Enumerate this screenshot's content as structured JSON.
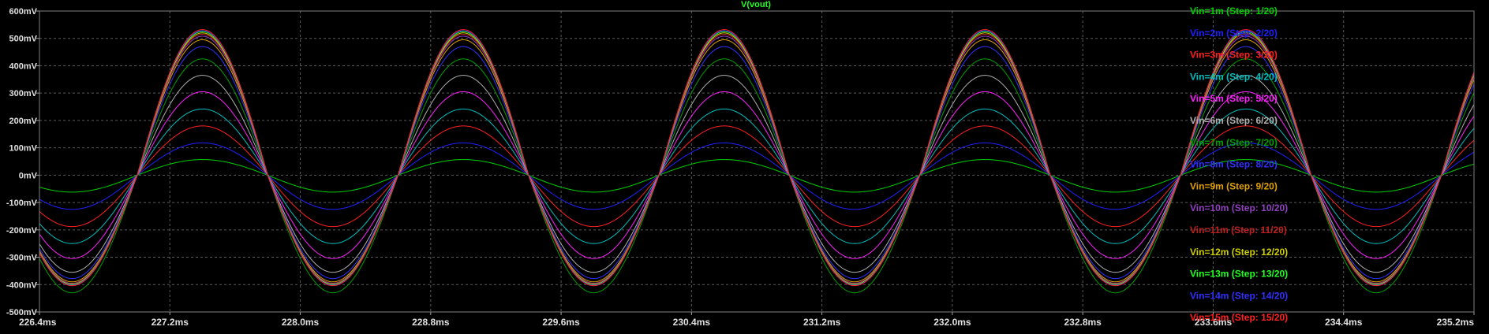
{
  "chart_data": {
    "type": "line",
    "title": "V(vout)",
    "xlabel": "",
    "ylabel": "",
    "xlim": [
      226.4,
      235.2
    ],
    "ylim": [
      -500,
      600
    ],
    "x_unit": "ms",
    "y_unit": "mV",
    "x_ticks": [
      "226.4ms",
      "227.2ms",
      "228.0ms",
      "228.8ms",
      "229.6ms",
      "230.4ms",
      "231.2ms",
      "232.0ms",
      "232.8ms",
      "233.6ms",
      "234.4ms",
      "235.2ms"
    ],
    "x_tick_values": [
      226.4,
      227.2,
      228.0,
      228.8,
      229.6,
      230.4,
      231.2,
      232.0,
      232.8,
      233.6,
      234.4,
      235.2
    ],
    "y_ticks": [
      "600mV",
      "500mV",
      "400mV",
      "300mV",
      "200mV",
      "100mV",
      "0mV",
      "-100mV",
      "-200mV",
      "-300mV",
      "-400mV",
      "-500mV"
    ],
    "y_tick_values": [
      600,
      500,
      400,
      300,
      200,
      100,
      0,
      -100,
      -200,
      -300,
      -400,
      -500
    ],
    "grid": true,
    "grid_style": "dashed",
    "legend_position": "right",
    "signal_period_ms": 1.6,
    "first_rising_zero_ms": 227.0,
    "series": [
      {
        "name": "Vin=1m  (Step: 1/20)",
        "color": "#00d000",
        "peak": 57,
        "trough": -62
      },
      {
        "name": "Vin=2m  (Step: 2/20)",
        "color": "#2020ff",
        "peak": 118,
        "trough": -125
      },
      {
        "name": "Vin=3m  (Step: 3/20)",
        "color": "#ff2020",
        "peak": 180,
        "trough": -188
      },
      {
        "name": "Vin=4m  (Step: 4/20)",
        "color": "#00c0c0",
        "peak": 242,
        "trough": -250
      },
      {
        "name": "Vin=5m  (Step: 5/20)",
        "color": "#ff20ff",
        "peak": 305,
        "trough": -305
      },
      {
        "name": "Vin=6m  (Step: 6/20)",
        "color": "#b0b0b0",
        "peak": 365,
        "trough": -355
      },
      {
        "name": "Vin=7m  (Step: 7/20)",
        "color": "#00a000",
        "peak": 425,
        "trough": -430
      },
      {
        "name": "Vin=8m  (Step: 8/20)",
        "color": "#3030ff",
        "peak": 470,
        "trough": -378
      },
      {
        "name": "Vin=9m  (Step: 9/20)",
        "color": "#e0a000",
        "peak": 495,
        "trough": -390
      },
      {
        "name": "Vin=10m  (Step: 10/20)",
        "color": "#9040c0",
        "peak": 508,
        "trough": -395
      },
      {
        "name": "Vin=11m  (Step: 11/20)",
        "color": "#c02020",
        "peak": 515,
        "trough": -397
      },
      {
        "name": "Vin=12m  (Step: 12/20)",
        "color": "#d0d000",
        "peak": 520,
        "trough": -399
      },
      {
        "name": "Vin=13m  (Step: 13/20)",
        "color": "#20ff20",
        "peak": 525,
        "trough": -400
      },
      {
        "name": "Vin=14m  (Step: 14/20)",
        "color": "#3030ff",
        "peak": 528,
        "trough": -402
      },
      {
        "name": "Vin=15m  (Step: 15/20)",
        "color": "#ff2020",
        "peak": 532,
        "trough": -404
      }
    ]
  }
}
